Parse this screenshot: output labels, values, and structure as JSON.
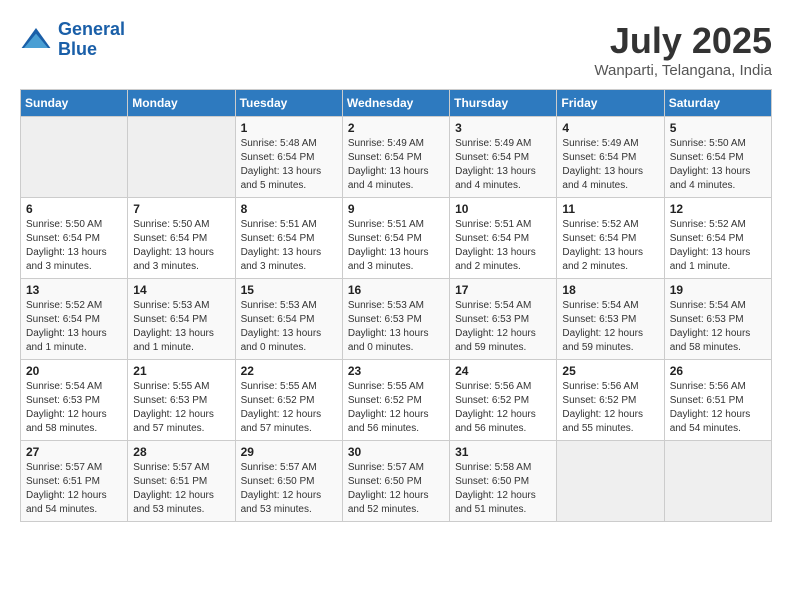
{
  "header": {
    "logo_line1": "General",
    "logo_line2": "Blue",
    "title": "July 2025",
    "subtitle": "Wanparti, Telangana, India"
  },
  "calendar": {
    "headers": [
      "Sunday",
      "Monday",
      "Tuesday",
      "Wednesday",
      "Thursday",
      "Friday",
      "Saturday"
    ],
    "weeks": [
      [
        {
          "day": "",
          "info": ""
        },
        {
          "day": "",
          "info": ""
        },
        {
          "day": "1",
          "info": "Sunrise: 5:48 AM\nSunset: 6:54 PM\nDaylight: 13 hours and 5 minutes."
        },
        {
          "day": "2",
          "info": "Sunrise: 5:49 AM\nSunset: 6:54 PM\nDaylight: 13 hours and 4 minutes."
        },
        {
          "day": "3",
          "info": "Sunrise: 5:49 AM\nSunset: 6:54 PM\nDaylight: 13 hours and 4 minutes."
        },
        {
          "day": "4",
          "info": "Sunrise: 5:49 AM\nSunset: 6:54 PM\nDaylight: 13 hours and 4 minutes."
        },
        {
          "day": "5",
          "info": "Sunrise: 5:50 AM\nSunset: 6:54 PM\nDaylight: 13 hours and 4 minutes."
        }
      ],
      [
        {
          "day": "6",
          "info": "Sunrise: 5:50 AM\nSunset: 6:54 PM\nDaylight: 13 hours and 3 minutes."
        },
        {
          "day": "7",
          "info": "Sunrise: 5:50 AM\nSunset: 6:54 PM\nDaylight: 13 hours and 3 minutes."
        },
        {
          "day": "8",
          "info": "Sunrise: 5:51 AM\nSunset: 6:54 PM\nDaylight: 13 hours and 3 minutes."
        },
        {
          "day": "9",
          "info": "Sunrise: 5:51 AM\nSunset: 6:54 PM\nDaylight: 13 hours and 3 minutes."
        },
        {
          "day": "10",
          "info": "Sunrise: 5:51 AM\nSunset: 6:54 PM\nDaylight: 13 hours and 2 minutes."
        },
        {
          "day": "11",
          "info": "Sunrise: 5:52 AM\nSunset: 6:54 PM\nDaylight: 13 hours and 2 minutes."
        },
        {
          "day": "12",
          "info": "Sunrise: 5:52 AM\nSunset: 6:54 PM\nDaylight: 13 hours and 1 minute."
        }
      ],
      [
        {
          "day": "13",
          "info": "Sunrise: 5:52 AM\nSunset: 6:54 PM\nDaylight: 13 hours and 1 minute."
        },
        {
          "day": "14",
          "info": "Sunrise: 5:53 AM\nSunset: 6:54 PM\nDaylight: 13 hours and 1 minute."
        },
        {
          "day": "15",
          "info": "Sunrise: 5:53 AM\nSunset: 6:54 PM\nDaylight: 13 hours and 0 minutes."
        },
        {
          "day": "16",
          "info": "Sunrise: 5:53 AM\nSunset: 6:53 PM\nDaylight: 13 hours and 0 minutes."
        },
        {
          "day": "17",
          "info": "Sunrise: 5:54 AM\nSunset: 6:53 PM\nDaylight: 12 hours and 59 minutes."
        },
        {
          "day": "18",
          "info": "Sunrise: 5:54 AM\nSunset: 6:53 PM\nDaylight: 12 hours and 59 minutes."
        },
        {
          "day": "19",
          "info": "Sunrise: 5:54 AM\nSunset: 6:53 PM\nDaylight: 12 hours and 58 minutes."
        }
      ],
      [
        {
          "day": "20",
          "info": "Sunrise: 5:54 AM\nSunset: 6:53 PM\nDaylight: 12 hours and 58 minutes."
        },
        {
          "day": "21",
          "info": "Sunrise: 5:55 AM\nSunset: 6:53 PM\nDaylight: 12 hours and 57 minutes."
        },
        {
          "day": "22",
          "info": "Sunrise: 5:55 AM\nSunset: 6:52 PM\nDaylight: 12 hours and 57 minutes."
        },
        {
          "day": "23",
          "info": "Sunrise: 5:55 AM\nSunset: 6:52 PM\nDaylight: 12 hours and 56 minutes."
        },
        {
          "day": "24",
          "info": "Sunrise: 5:56 AM\nSunset: 6:52 PM\nDaylight: 12 hours and 56 minutes."
        },
        {
          "day": "25",
          "info": "Sunrise: 5:56 AM\nSunset: 6:52 PM\nDaylight: 12 hours and 55 minutes."
        },
        {
          "day": "26",
          "info": "Sunrise: 5:56 AM\nSunset: 6:51 PM\nDaylight: 12 hours and 54 minutes."
        }
      ],
      [
        {
          "day": "27",
          "info": "Sunrise: 5:57 AM\nSunset: 6:51 PM\nDaylight: 12 hours and 54 minutes."
        },
        {
          "day": "28",
          "info": "Sunrise: 5:57 AM\nSunset: 6:51 PM\nDaylight: 12 hours and 53 minutes."
        },
        {
          "day": "29",
          "info": "Sunrise: 5:57 AM\nSunset: 6:50 PM\nDaylight: 12 hours and 53 minutes."
        },
        {
          "day": "30",
          "info": "Sunrise: 5:57 AM\nSunset: 6:50 PM\nDaylight: 12 hours and 52 minutes."
        },
        {
          "day": "31",
          "info": "Sunrise: 5:58 AM\nSunset: 6:50 PM\nDaylight: 12 hours and 51 minutes."
        },
        {
          "day": "",
          "info": ""
        },
        {
          "day": "",
          "info": ""
        }
      ]
    ]
  }
}
